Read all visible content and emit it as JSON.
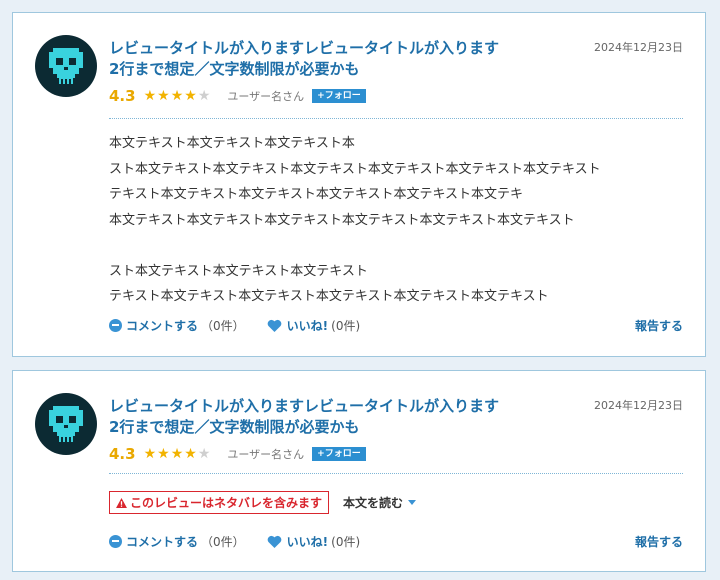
{
  "reviews": [
    {
      "title_line1": "レビュータイトルが入りますレビュータイトルが入ります",
      "title_line2": "2行まで想定／文字数制限が必要かも",
      "date": "2024年12月23日",
      "score": "4.3",
      "stars_filled": 4,
      "stars_total": 5,
      "username": "ユーザー名さん",
      "follow_label": "+フォロー",
      "body_lines": [
        "本文テキスト本文テキスト本文テキスト本",
        "スト本文テキスト本文テキスト本文テキスト本文テキスト本文テキスト本文テキスト",
        "テキスト本文テキスト本文テキスト本文テキスト本文テキスト本文テキ",
        "本文テキスト本文テキスト本文テキスト本文テキスト本文テキスト本文テキスト",
        "",
        "スト本文テキスト本文テキスト本文テキスト",
        "テキスト本文テキスト本文テキスト本文テキスト本文テキスト本文テキスト"
      ],
      "comment_label": "コメントする",
      "comment_count": "（0件）",
      "like_label": "いいね!",
      "like_count": "(0件)",
      "report_label": "報告する"
    },
    {
      "title_line1": "レビュータイトルが入りますレビュータイトルが入ります",
      "title_line2": "2行まで想定／文字数制限が必要かも",
      "date": "2024年12月23日",
      "score": "4.3",
      "stars_filled": 4,
      "stars_total": 5,
      "username": "ユーザー名さん",
      "follow_label": "+フォロー",
      "spoiler_label": "このレビューはネタバレを含みます",
      "read_more_label": "本文を読む",
      "comment_label": "コメントする",
      "comment_count": "（0件）",
      "like_label": "いいね!",
      "like_count": "(0件)",
      "report_label": "報告する"
    }
  ],
  "colors": {
    "accent": "#1f6fa8",
    "star": "#f2b300",
    "spoiler": "#d9262e",
    "follow_bg": "#2c8fd1"
  },
  "icons": {
    "avatar": "skull-icon",
    "star": "star-icon",
    "comment": "comment-bubble-icon",
    "like": "heart-icon",
    "spoiler": "warning-icon",
    "read_more": "caret-down-icon"
  }
}
